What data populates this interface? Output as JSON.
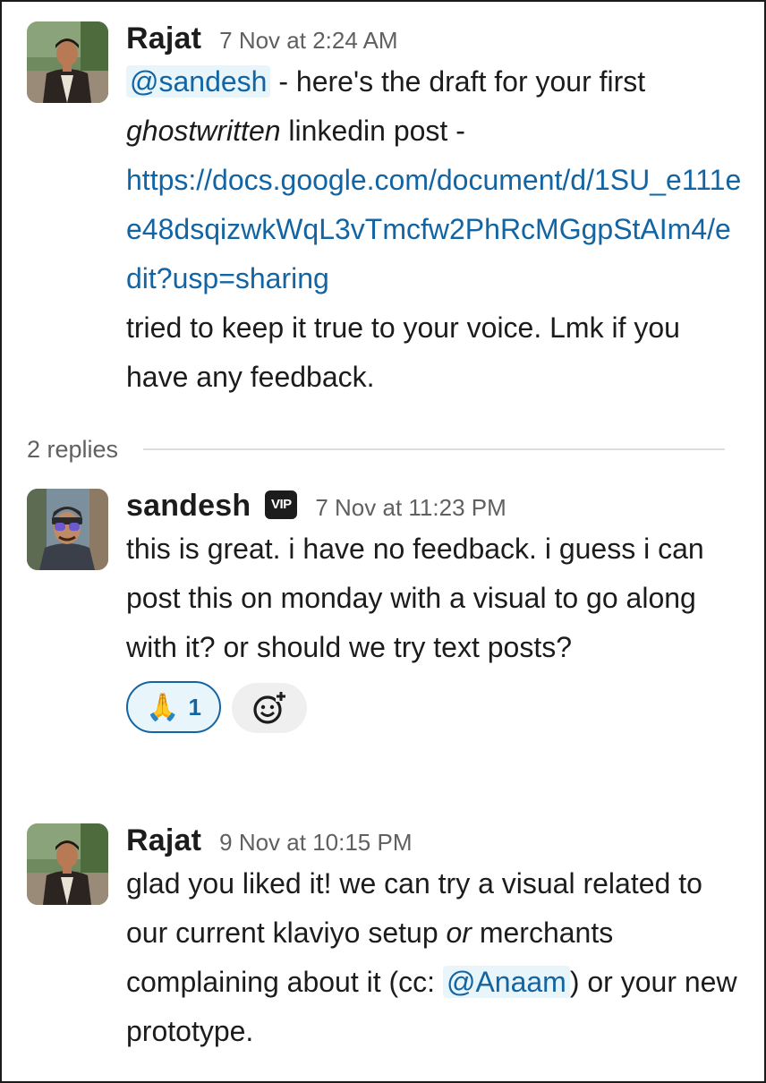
{
  "messages": [
    {
      "author": "Rajat",
      "timestamp": "7 Nov at 2:24 AM",
      "mention": "@sandesh",
      "text_1": " - here's the draft for your first ",
      "emphasis": "ghostwritten",
      "text_2": " linkedin post - ",
      "link": "https://docs.google.com/document/d/1SU_e111ee48dsqizwkWqL3vTmcfw2PhRcMGgpStAIm4/edit?usp=sharing",
      "text_3": "tried to keep it true to your voice. Lmk if you have any feedback."
    },
    {
      "author": "sandesh",
      "badge": "VIP",
      "timestamp": "7 Nov at 11:23 PM",
      "text": "this is great. i have no feedback. i guess i can post this on monday with a visual to go along with it? or should we try text posts?",
      "reaction": {
        "emoji": "🙏",
        "count": "1"
      }
    },
    {
      "author": "Rajat",
      "timestamp": "9 Nov at 10:15 PM",
      "text_1": "glad you liked it! we can try a visual related to our current klaviyo setup ",
      "emphasis": "or",
      "text_2": " merchants complaining about it (cc: ",
      "mention": "@Anaam",
      "text_3": ") or your new prototype."
    }
  ],
  "thread": {
    "replies_label": "2 replies"
  },
  "icons": {
    "add_reaction": "add-reaction-smiley-icon"
  },
  "colors": {
    "link": "#1264a3",
    "mention_bg": "#e8f5fa",
    "text": "#1d1c1d",
    "muted": "#616061"
  }
}
